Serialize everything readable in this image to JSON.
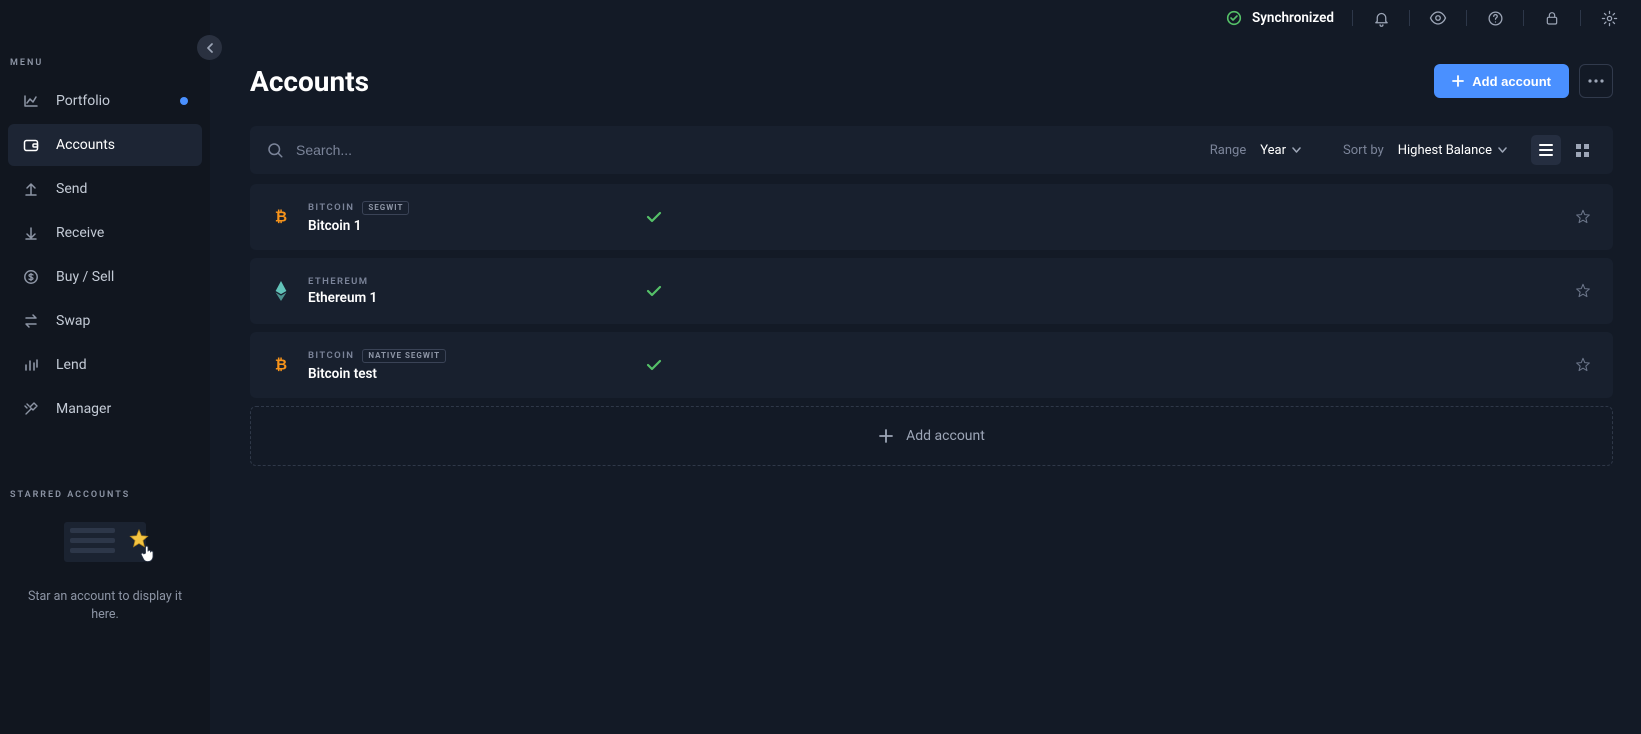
{
  "sidebar": {
    "menu_label": "MENU",
    "items": [
      {
        "label": "Portfolio"
      },
      {
        "label": "Accounts"
      },
      {
        "label": "Send"
      },
      {
        "label": "Receive"
      },
      {
        "label": "Buy / Sell"
      },
      {
        "label": "Swap"
      },
      {
        "label": "Lend"
      },
      {
        "label": "Manager"
      }
    ],
    "starred_label": "STARRED ACCOUNTS",
    "starred_empty_text": "Star an account to display it here."
  },
  "topbar": {
    "sync_status": "Synchronized"
  },
  "page": {
    "title": "Accounts",
    "add_account_label": "Add account"
  },
  "toolbar": {
    "search_placeholder": "Search...",
    "range_label": "Range",
    "range_value": "Year",
    "sort_label": "Sort by",
    "sort_value": "Highest Balance"
  },
  "accounts": [
    {
      "coin": "BITCOIN",
      "badge": "SEGWIT",
      "name": "Bitcoin 1",
      "coin_type": "btc"
    },
    {
      "coin": "ETHEREUM",
      "badge": "",
      "name": "Ethereum 1",
      "coin_type": "eth"
    },
    {
      "coin": "BITCOIN",
      "badge": "NATIVE SEGWIT",
      "name": "Bitcoin test",
      "coin_type": "btc"
    }
  ],
  "add_row_label": "Add account"
}
